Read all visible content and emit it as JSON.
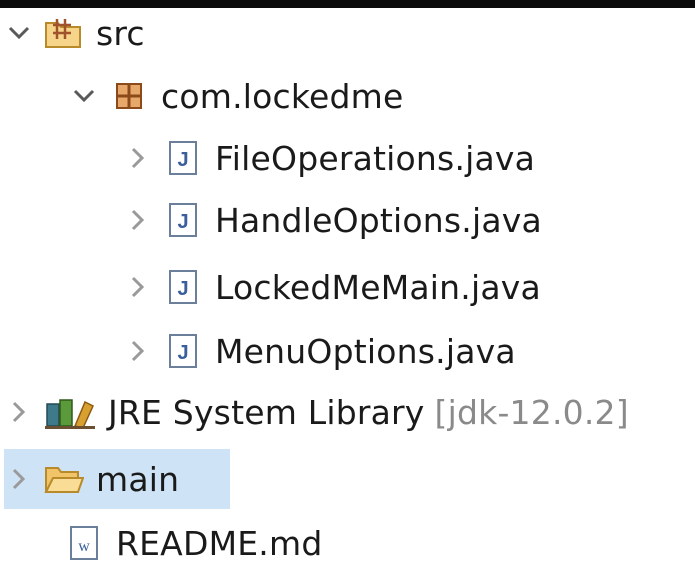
{
  "tree": {
    "src": {
      "label": "src"
    },
    "package": {
      "label": "com.lockedme"
    },
    "files": [
      {
        "label": "FileOperations.java"
      },
      {
        "label": "HandleOptions.java"
      },
      {
        "label": "LockedMeMain.java"
      },
      {
        "label": "MenuOptions.java"
      }
    ],
    "jre": {
      "label": "JRE System Library",
      "decoration": "[jdk-12.0.2]"
    },
    "main": {
      "label": "main"
    },
    "readme": {
      "label": "README.md"
    }
  },
  "icons": {
    "src": "source-folder-icon",
    "package": "package-icon",
    "java": "java-file-icon",
    "library": "library-icon",
    "folder": "folder-icon",
    "markdown": "markdown-file-icon"
  }
}
